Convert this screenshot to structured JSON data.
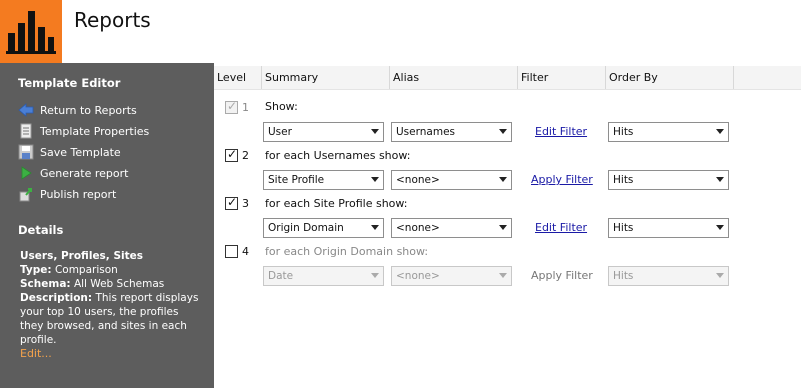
{
  "app": {
    "title": "Reports"
  },
  "sidebar": {
    "editor_heading": "Template Editor",
    "items": [
      {
        "label": "Return to Reports",
        "icon": "back-arrow-icon"
      },
      {
        "label": "Template Properties",
        "icon": "document-icon"
      },
      {
        "label": "Save Template",
        "icon": "save-icon"
      },
      {
        "label": "Generate report",
        "icon": "play-icon"
      },
      {
        "label": "Publish report",
        "icon": "publish-icon"
      }
    ],
    "details_heading": "Details",
    "details": {
      "name": "Users, Profiles, Sites",
      "type_label": "Type:",
      "type_value": "Comparison",
      "schema_label": "Schema:",
      "schema_value": "All Web Schemas",
      "description_label": "Description:",
      "description_value": "This report displays your top 10 users, the profiles they browsed, and sites in each profile."
    },
    "edit_link": "Edit..."
  },
  "table": {
    "headers": [
      "Level",
      "Summary",
      "Alias",
      "Filter",
      "Order By"
    ],
    "rows": [
      {
        "level": "1",
        "checked": true,
        "disabled": true,
        "show": "Show:",
        "summary": "User",
        "alias": "Usernames",
        "filter": "Edit Filter",
        "order_by": "Hits"
      },
      {
        "level": "2",
        "checked": true,
        "disabled": false,
        "show": "for each Usernames show:",
        "summary": "Site Profile",
        "alias": "<none>",
        "filter": "Apply Filter",
        "order_by": "Hits"
      },
      {
        "level": "3",
        "checked": true,
        "disabled": false,
        "show": "for each Site Profile show:",
        "summary": "Origin Domain",
        "alias": "<none>",
        "filter": "Edit Filter",
        "order_by": "Hits"
      },
      {
        "level": "4",
        "checked": false,
        "disabled": false,
        "show": "for each Origin Domain show:",
        "summary": "Date",
        "alias": "<none>",
        "filter": "Apply Filter",
        "order_by": "Hits"
      }
    ]
  },
  "colors": {
    "brand": "#f47b20",
    "sidebar": "#5d5d5d",
    "link": "#1a1aa6",
    "edit_link": "#f3a24c"
  }
}
